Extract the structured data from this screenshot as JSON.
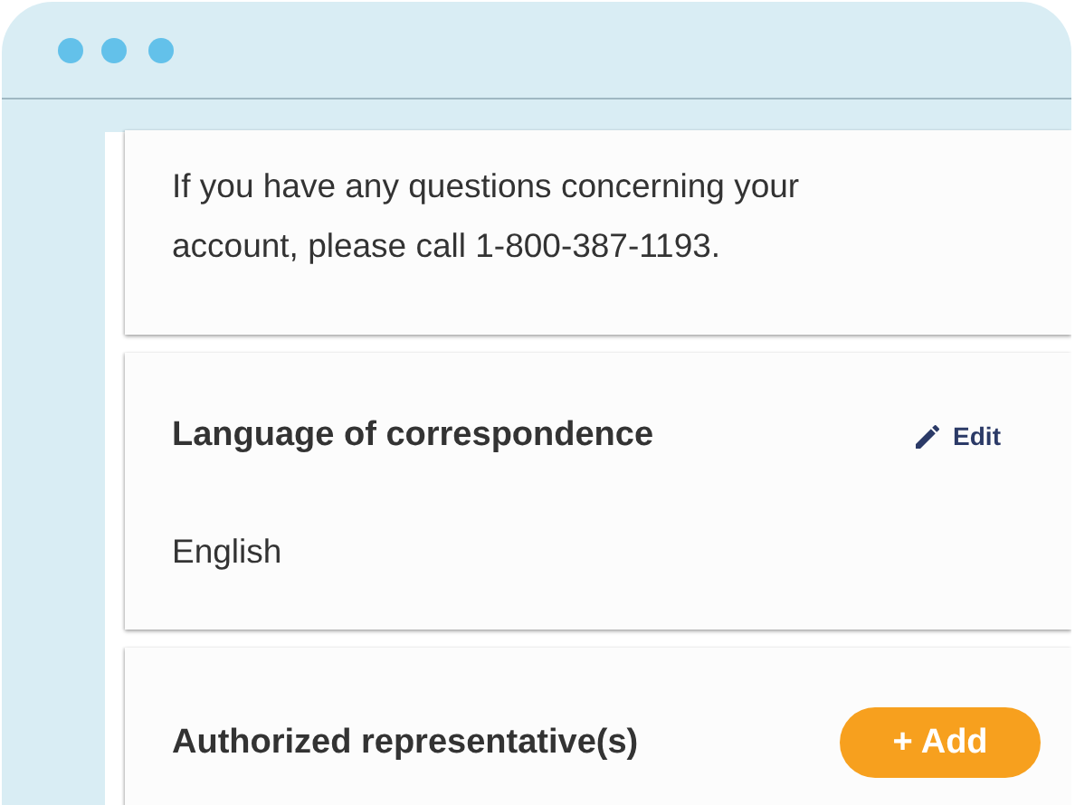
{
  "notice": {
    "text": "If you have any questions concerning your account, please call 1-800-387-1193."
  },
  "sections": [
    {
      "title": "Language of correspondence",
      "action": {
        "kind": "edit",
        "label": "Edit"
      },
      "value": "English"
    },
    {
      "title": "Authorized representative(s)",
      "action": {
        "kind": "add",
        "label": "+ Add"
      }
    }
  ]
}
